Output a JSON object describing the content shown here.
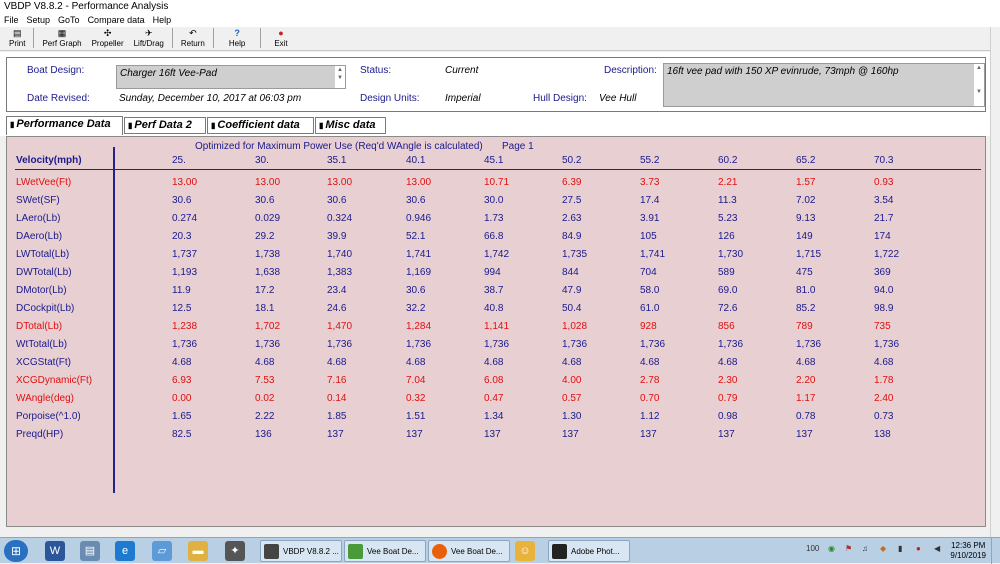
{
  "window": {
    "title": "VBDP V8.8.2 - Performance Analysis"
  },
  "menu": [
    "File",
    "Setup",
    "GoTo",
    "Compare data",
    "Help"
  ],
  "toolbar": [
    {
      "label": "Print",
      "icon": "printer-icon",
      "glyph": "▤"
    },
    {
      "label": "Perf Graph",
      "icon": "graph-icon",
      "glyph": "▦"
    },
    {
      "label": "Propeller",
      "icon": "propeller-icon",
      "glyph": "✣"
    },
    {
      "label": "Lift/Drag",
      "icon": "lift-drag-icon",
      "glyph": "✈"
    },
    {
      "label": "Return",
      "icon": "return-icon",
      "glyph": "↶"
    },
    {
      "label": "Help",
      "icon": "help-icon",
      "glyph": "?"
    },
    {
      "label": "Exit",
      "icon": "exit-icon",
      "glyph": "●"
    }
  ],
  "header": {
    "boat_design_label": "Boat Design:",
    "boat_design_value": "Charger 16ft Vee-Pad",
    "status_label": "Status:",
    "status_value": "Current",
    "description_label": "Description:",
    "description_value": "16ft vee pad with 150 XP evinrude, 73mph @ 160hp",
    "date_revised_label": "Date Revised:",
    "date_revised_value": "Sunday, December 10, 2017 at 06:03 pm",
    "design_units_label": "Design Units:",
    "design_units_value": "Imperial",
    "hull_design_label": "Hull Design:",
    "hull_design_value": "Vee Hull"
  },
  "tabs": [
    "Performance Data",
    "Perf Data 2",
    "Coefficient data",
    "Misc data"
  ],
  "panel": {
    "subtitle": "Optimized for Maximum Power Use (Req'd WAngle is calculated)",
    "page": "Page 1"
  },
  "table": {
    "header_label": "Velocity(mph)",
    "velocities": [
      "25.",
      "30.",
      "35.1",
      "40.1",
      "45.1",
      "50.2",
      "55.2",
      "60.2",
      "65.2",
      "70.3"
    ],
    "rows": [
      {
        "label": "LWetVee(Ft)",
        "color": "red",
        "values": [
          "13.00",
          "13.00",
          "13.00",
          "13.00",
          "10.71",
          "6.39",
          "3.73",
          "2.21",
          "1.57",
          "0.93"
        ]
      },
      {
        "label": "SWet(SF)",
        "color": "blue",
        "values": [
          "30.6",
          "30.6",
          "30.6",
          "30.6",
          "30.0",
          "27.5",
          "17.4",
          "11.3",
          "7.02",
          "3.54"
        ]
      },
      {
        "label": "LAero(Lb)",
        "color": "blue",
        "values": [
          "0.274",
          "0.029",
          "0.324",
          "0.946",
          "1.73",
          "2.63",
          "3.91",
          "5.23",
          "9.13",
          "21.7"
        ]
      },
      {
        "label": "DAero(Lb)",
        "color": "blue",
        "values": [
          "20.3",
          "29.2",
          "39.9",
          "52.1",
          "66.8",
          "84.9",
          "105",
          "126",
          "149",
          "174"
        ]
      },
      {
        "label": "LWTotal(Lb)",
        "color": "blue",
        "values": [
          "1,737",
          "1,738",
          "1,740",
          "1,741",
          "1,742",
          "1,735",
          "1,741",
          "1,730",
          "1,715",
          "1,722"
        ]
      },
      {
        "label": "DWTotal(Lb)",
        "color": "blue",
        "values": [
          "1,193",
          "1,638",
          "1,383",
          "1,169",
          "994",
          "844",
          "704",
          "589",
          "475",
          "369"
        ]
      },
      {
        "label": "DMotor(Lb)",
        "color": "blue",
        "values": [
          "11.9",
          "17.2",
          "23.4",
          "30.6",
          "38.7",
          "47.9",
          "58.0",
          "69.0",
          "81.0",
          "94.0"
        ]
      },
      {
        "label": "DCockpit(Lb)",
        "color": "blue",
        "values": [
          "12.5",
          "18.1",
          "24.6",
          "32.2",
          "40.8",
          "50.4",
          "61.0",
          "72.6",
          "85.2",
          "98.9"
        ]
      },
      {
        "label": "DTotal(Lb)",
        "color": "red",
        "values": [
          "1,238",
          "1,702",
          "1,470",
          "1,284",
          "1,141",
          "1,028",
          "928",
          "856",
          "789",
          "735"
        ]
      },
      {
        "label": "WtTotal(Lb)",
        "color": "blue",
        "values": [
          "1,736",
          "1,736",
          "1,736",
          "1,736",
          "1,736",
          "1,736",
          "1,736",
          "1,736",
          "1,736",
          "1,736"
        ]
      },
      {
        "label": "XCGStat(Ft)",
        "color": "blue",
        "values": [
          "4.68",
          "4.68",
          "4.68",
          "4.68",
          "4.68",
          "4.68",
          "4.68",
          "4.68",
          "4.68",
          "4.68"
        ]
      },
      {
        "label": "XCGDynamic(Ft)",
        "color": "red",
        "values": [
          "6.93",
          "7.53",
          "7.16",
          "7.04",
          "6.08",
          "4.00",
          "2.78",
          "2.30",
          "2.20",
          "1.78"
        ]
      },
      {
        "label": "WAngle(deg)",
        "color": "red",
        "values": [
          "0.00",
          "0.02",
          "0.14",
          "0.32",
          "0.47",
          "0.57",
          "0.70",
          "0.79",
          "1.17",
          "2.40"
        ]
      },
      {
        "label": "Porpoise(^1.0)",
        "color": "blue",
        "values": [
          "1.65",
          "2.22",
          "1.85",
          "1.51",
          "1.34",
          "1.30",
          "1.12",
          "0.98",
          "0.78",
          "0.73"
        ]
      },
      {
        "label": "Preqd(HP)",
        "color": "blue",
        "values": [
          "82.5",
          "136",
          "137",
          "137",
          "137",
          "137",
          "137",
          "137",
          "137",
          "138"
        ]
      }
    ]
  },
  "taskbar": {
    "apps": [
      "VBDP V8.8.2 ...",
      "Vee Boat De...",
      "Vee Boat De...",
      "Adobe Phot..."
    ],
    "clock_time": "12:36 PM",
    "clock_date": "9/10/2019",
    "tray_text": "100"
  },
  "colors": {
    "red": "#e01010",
    "blue": "#1a1a8c",
    "panel_bg": "#e8cfd2"
  }
}
